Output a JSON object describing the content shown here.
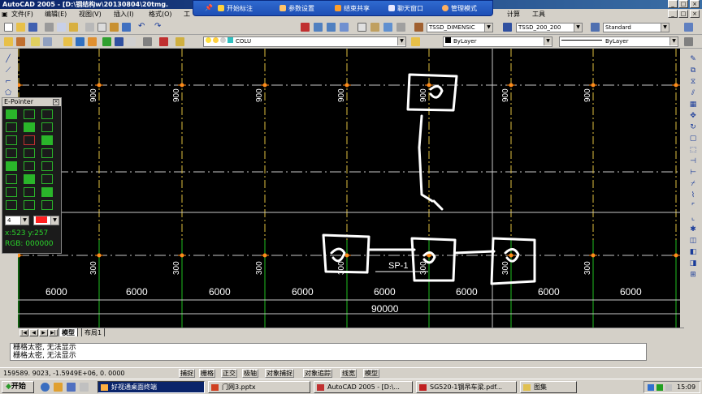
{
  "window": {
    "title": "AutoCAD 2005 - [D:\\钢结构w\\20130804\\20tmg.",
    "controls": [
      "_",
      "□",
      "×"
    ],
    "doc_controls": [
      "_",
      "□",
      "×"
    ]
  },
  "menu": {
    "items": [
      "文件(F)",
      "编辑(E)",
      "视图(V)",
      "插入(I)",
      "格式(O)",
      "工",
      "计算",
      "工具"
    ]
  },
  "overlay_toolbar": {
    "items": [
      "开始标注",
      "参数设置",
      "结束共享",
      "聊天窗口",
      "管理模式"
    ]
  },
  "toolbars": {
    "dim_style": "TSSD_DIMENSIC",
    "text_style": "TSSD_200_200",
    "table_style": "Standard",
    "layer": "COLU",
    "color": "ByLayer",
    "linetype": "ByLayer"
  },
  "drawing": {
    "label_top": "900",
    "label_bottom": "300",
    "dimension": "6000",
    "total": "90000",
    "tag": "SP-1"
  },
  "epointer": {
    "title": "E-Pointer",
    "size_value": "4",
    "coords": "x:523  y:257",
    "rgb": "RGB: 000000"
  },
  "tabs": {
    "model": "模型",
    "layout": "布局1"
  },
  "command_lines": [
    "栅格太密, 无法显示",
    "栅格太密, 无法显示"
  ],
  "status": {
    "coords": "159589. 9023, -1.5949E+06, 0. 0000",
    "buttons": [
      "捕捉",
      "栅格",
      "正交",
      "极轴",
      "对象捕捉",
      "对象追踪",
      "线宽",
      "模型"
    ]
  },
  "taskbar": {
    "start": "开始",
    "tasks": [
      "好视通桌面终端",
      "门网3.pptx",
      "AutoCAD 2005 - [D:\\...",
      "SG520-1钢吊车梁.pdf...",
      "图集"
    ],
    "clock": "15:09"
  },
  "colors": {
    "canvas": "#000000",
    "titlebar": "#0a246a",
    "grid_yellow": "#e0c040",
    "grid_green": "#20c020",
    "grid_white": "#c8c8c8",
    "node_orange": "#ff8c1a",
    "epointer_text": "#2bd42b"
  }
}
